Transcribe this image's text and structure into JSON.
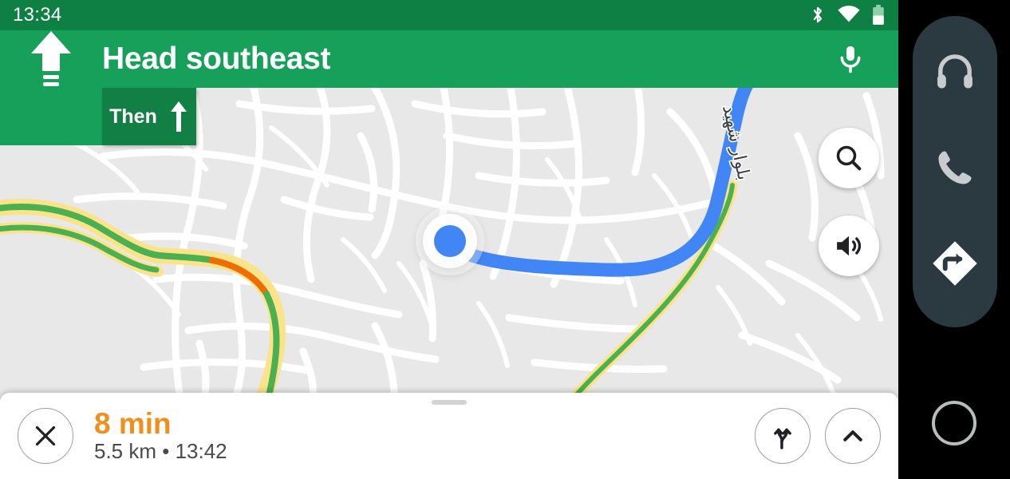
{
  "status_bar": {
    "clock": "13:34",
    "icons": [
      "bluetooth-icon",
      "wifi-icon",
      "battery-icon"
    ],
    "battery_level_pct": 50,
    "background_color": "#0e8043"
  },
  "nav_header": {
    "instruction": "Head southeast",
    "maneuver_icon": "straight-ahead-arrow-icon",
    "mic_icon": "microphone-icon",
    "background_color": "#16a05a",
    "then": {
      "label": "Then",
      "icon": "straight-up-arrow-icon",
      "background_color": "#128045"
    }
  },
  "map": {
    "background_color": "#e8e8e8",
    "road_color": "#ffffff",
    "route_color": "#4285f4",
    "street_label": "بلوار شهید",
    "traffic": {
      "free_flow_color": "#4caf50",
      "slow_color": "#ef6c00",
      "highway_color": "#fbe38a"
    },
    "user_location_marker": "location-puck-icon",
    "fabs": [
      {
        "name": "search-fab",
        "icon": "search-icon"
      },
      {
        "name": "volume-fab",
        "icon": "volume-icon"
      }
    ]
  },
  "bottom_sheet": {
    "close_icon": "close-x-icon",
    "eta": "8 min",
    "detail": "5.5 km  •  13:42",
    "eta_color": "#ef8f1c",
    "actions": [
      {
        "name": "alternate-routes-button",
        "icon": "route-fork-icon"
      },
      {
        "name": "expand-sheet-button",
        "icon": "chevron-up-icon"
      }
    ]
  },
  "system_bar": {
    "background_color": "#000000",
    "pill_color": "#2b3a41",
    "items": [
      {
        "name": "media-button",
        "icon": "headphones-icon"
      },
      {
        "name": "phone-button",
        "icon": "phone-icon"
      },
      {
        "name": "navigation-button",
        "icon": "navigation-diamond-icon"
      }
    ],
    "home_icon": "home-circle-icon"
  }
}
